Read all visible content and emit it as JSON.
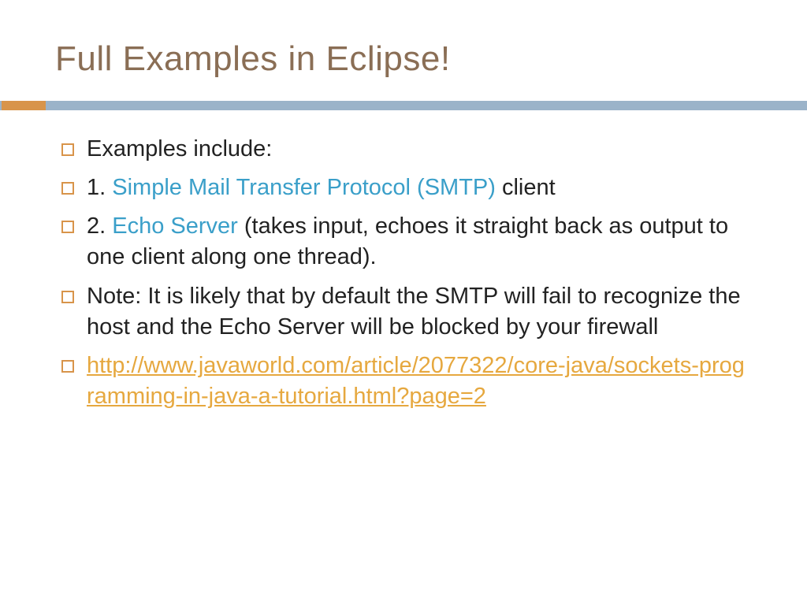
{
  "title": "Full Examples in Eclipse!",
  "bullets": {
    "b0": {
      "text": "Examples include:"
    },
    "b1": {
      "prefix": "1. ",
      "highlight": "Simple Mail Transfer Protocol (SMTP)",
      "suffix": " client"
    },
    "b2": {
      "prefix": "2. ",
      "highlight": "Echo Server",
      "suffix": " (takes input, echoes it straight back as output to one client along one thread)."
    },
    "b3": {
      "text": "Note: It is likely that by default the SMTP will fail to recognize the host and the Echo Server will be blocked by your firewall"
    },
    "b4": {
      "link": "http://www.javaworld.com/article/2077322/core-java/sockets-programming-in-java-a-tutorial.html?page=2"
    }
  }
}
